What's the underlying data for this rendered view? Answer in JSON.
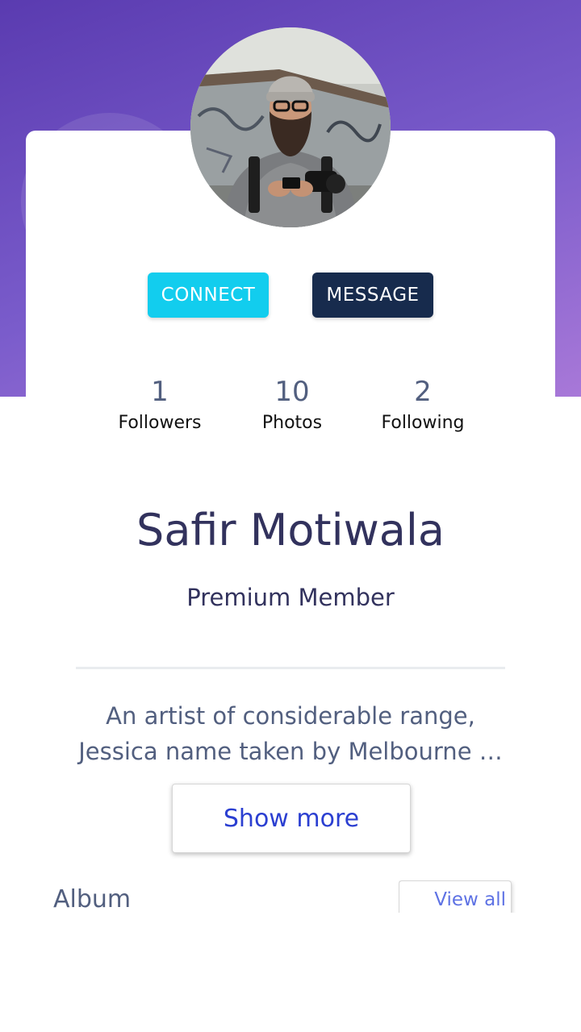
{
  "profile": {
    "avatar_alt": "Profile photo",
    "name": "Safir Motiwala",
    "role": "Premium Member",
    "bio": "An artist of considerable range, Jessica name taken by Melbourne …"
  },
  "actions": {
    "connect_label": "CONNECT",
    "message_label": "MESSAGE"
  },
  "stats": [
    {
      "value": "1",
      "label": "Followers"
    },
    {
      "value": "10",
      "label": "Photos"
    },
    {
      "value": "2",
      "label": "Following"
    }
  ],
  "bio_section": {
    "show_more_label": "Show more"
  },
  "album": {
    "title": "Album",
    "view_all_label": "View all"
  },
  "colors": {
    "gradient_start": "#5a3bb0",
    "gradient_end": "#a878d8",
    "connect": "#12cdee",
    "message": "#172b4d",
    "heading": "#32325d",
    "body_text": "#525f7f",
    "link": "#2b3fd1"
  }
}
